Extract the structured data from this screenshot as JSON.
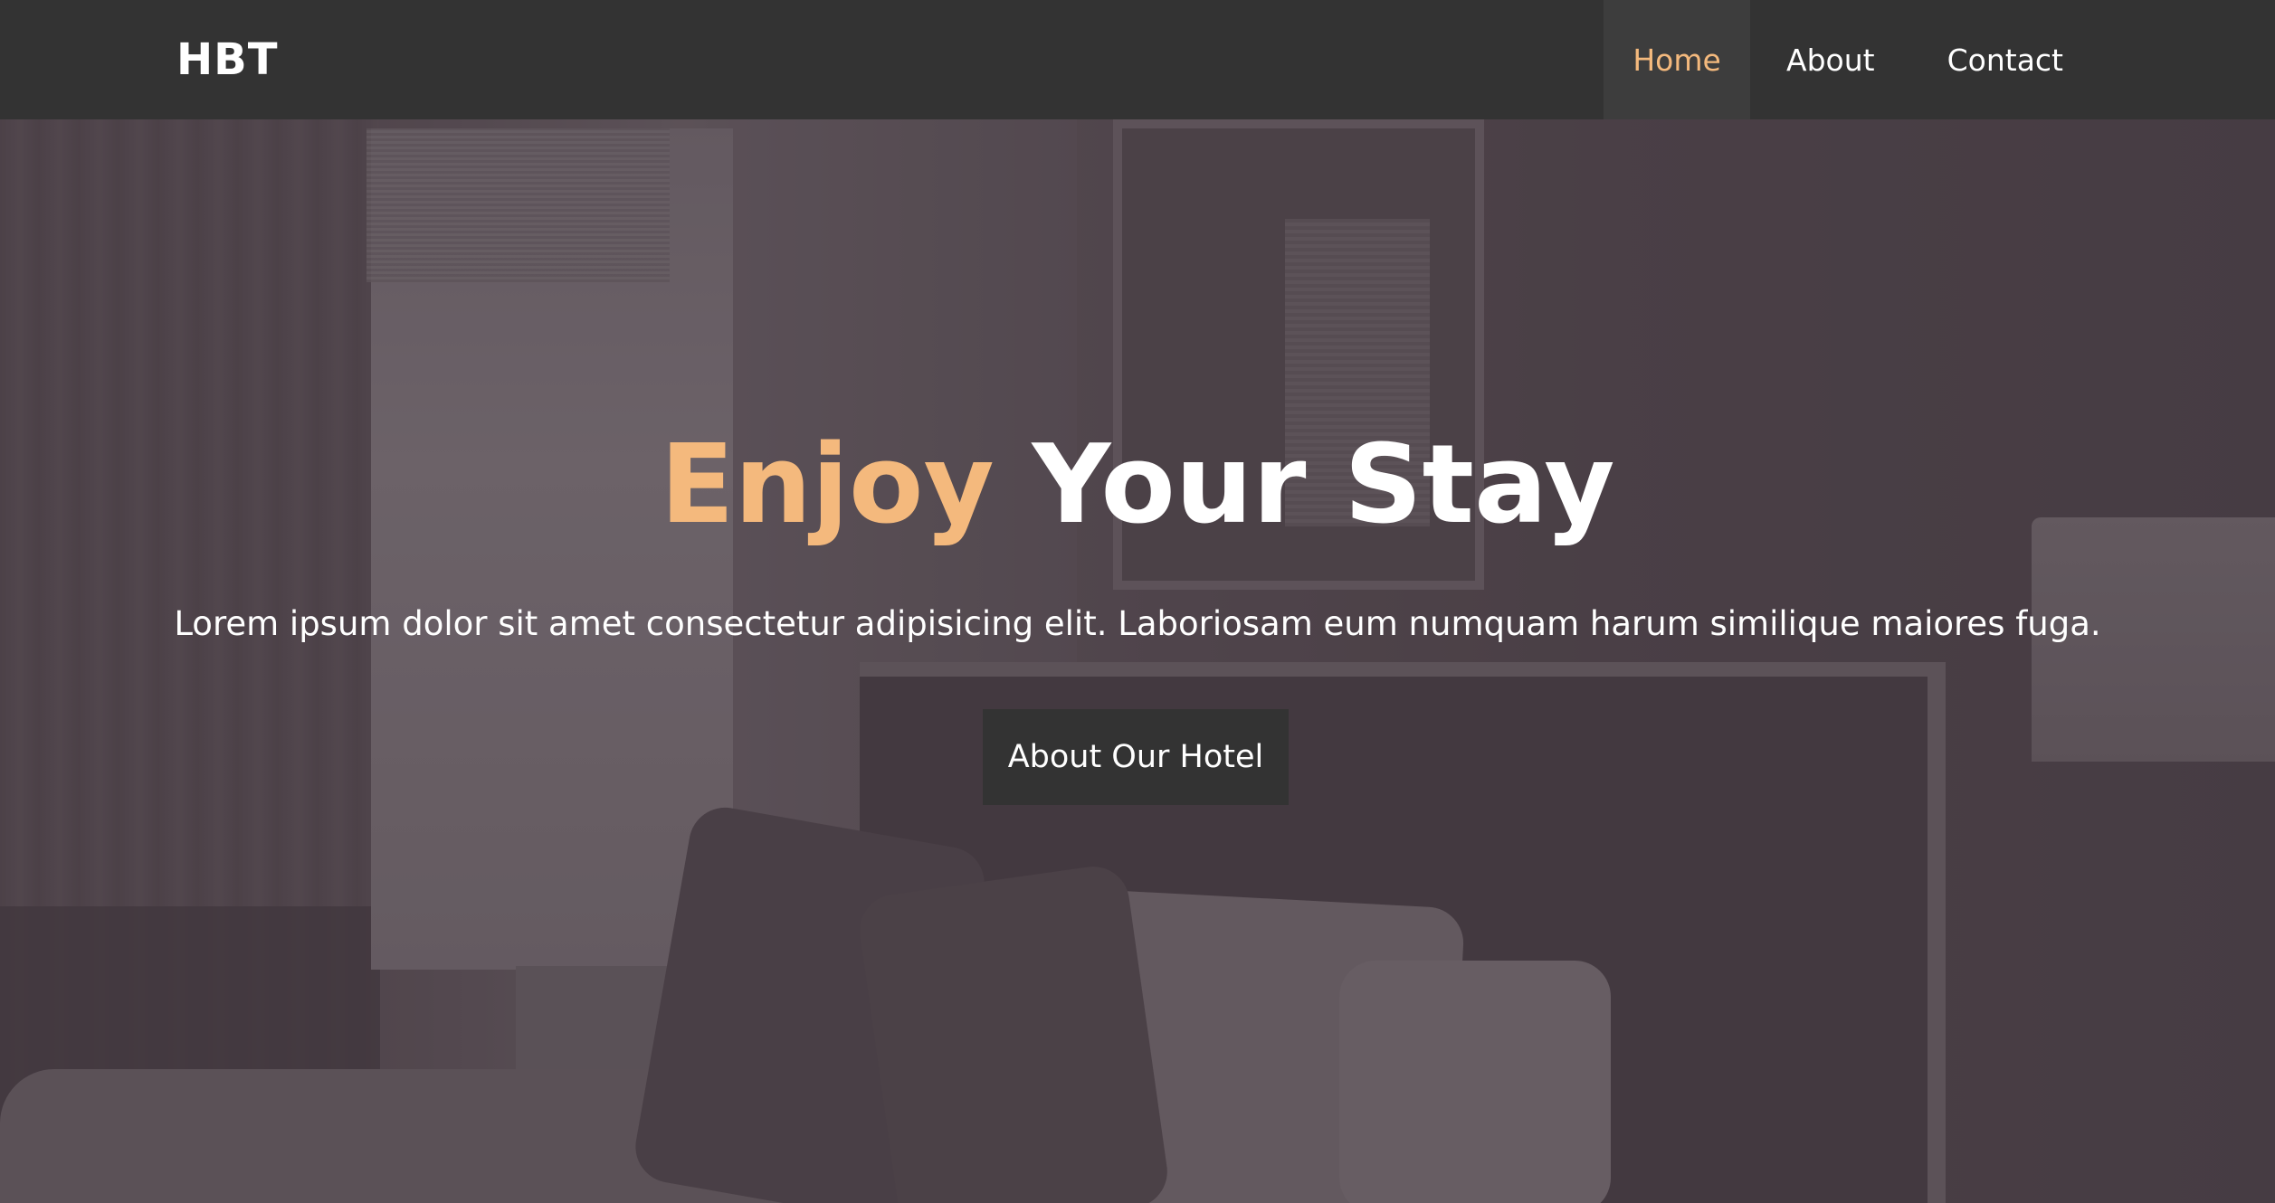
{
  "navbar": {
    "brand": "HBT",
    "links": [
      {
        "label": "Home",
        "active": true
      },
      {
        "label": "About",
        "active": false
      },
      {
        "label": "Contact",
        "active": false
      }
    ]
  },
  "hero": {
    "title_accent": "Enjoy",
    "title_rest": "Your Stay",
    "subtitle": "Lorem ipsum dolor sit amet consectetur adipisicing elit. Laboriosam eum numquam harum similique maiores fuga.",
    "button_label": "About Our Hotel"
  },
  "colors": {
    "navbar_bg": "#333333",
    "accent": "#f4b97d",
    "text": "#ffffff",
    "button_bg": "#333333"
  }
}
